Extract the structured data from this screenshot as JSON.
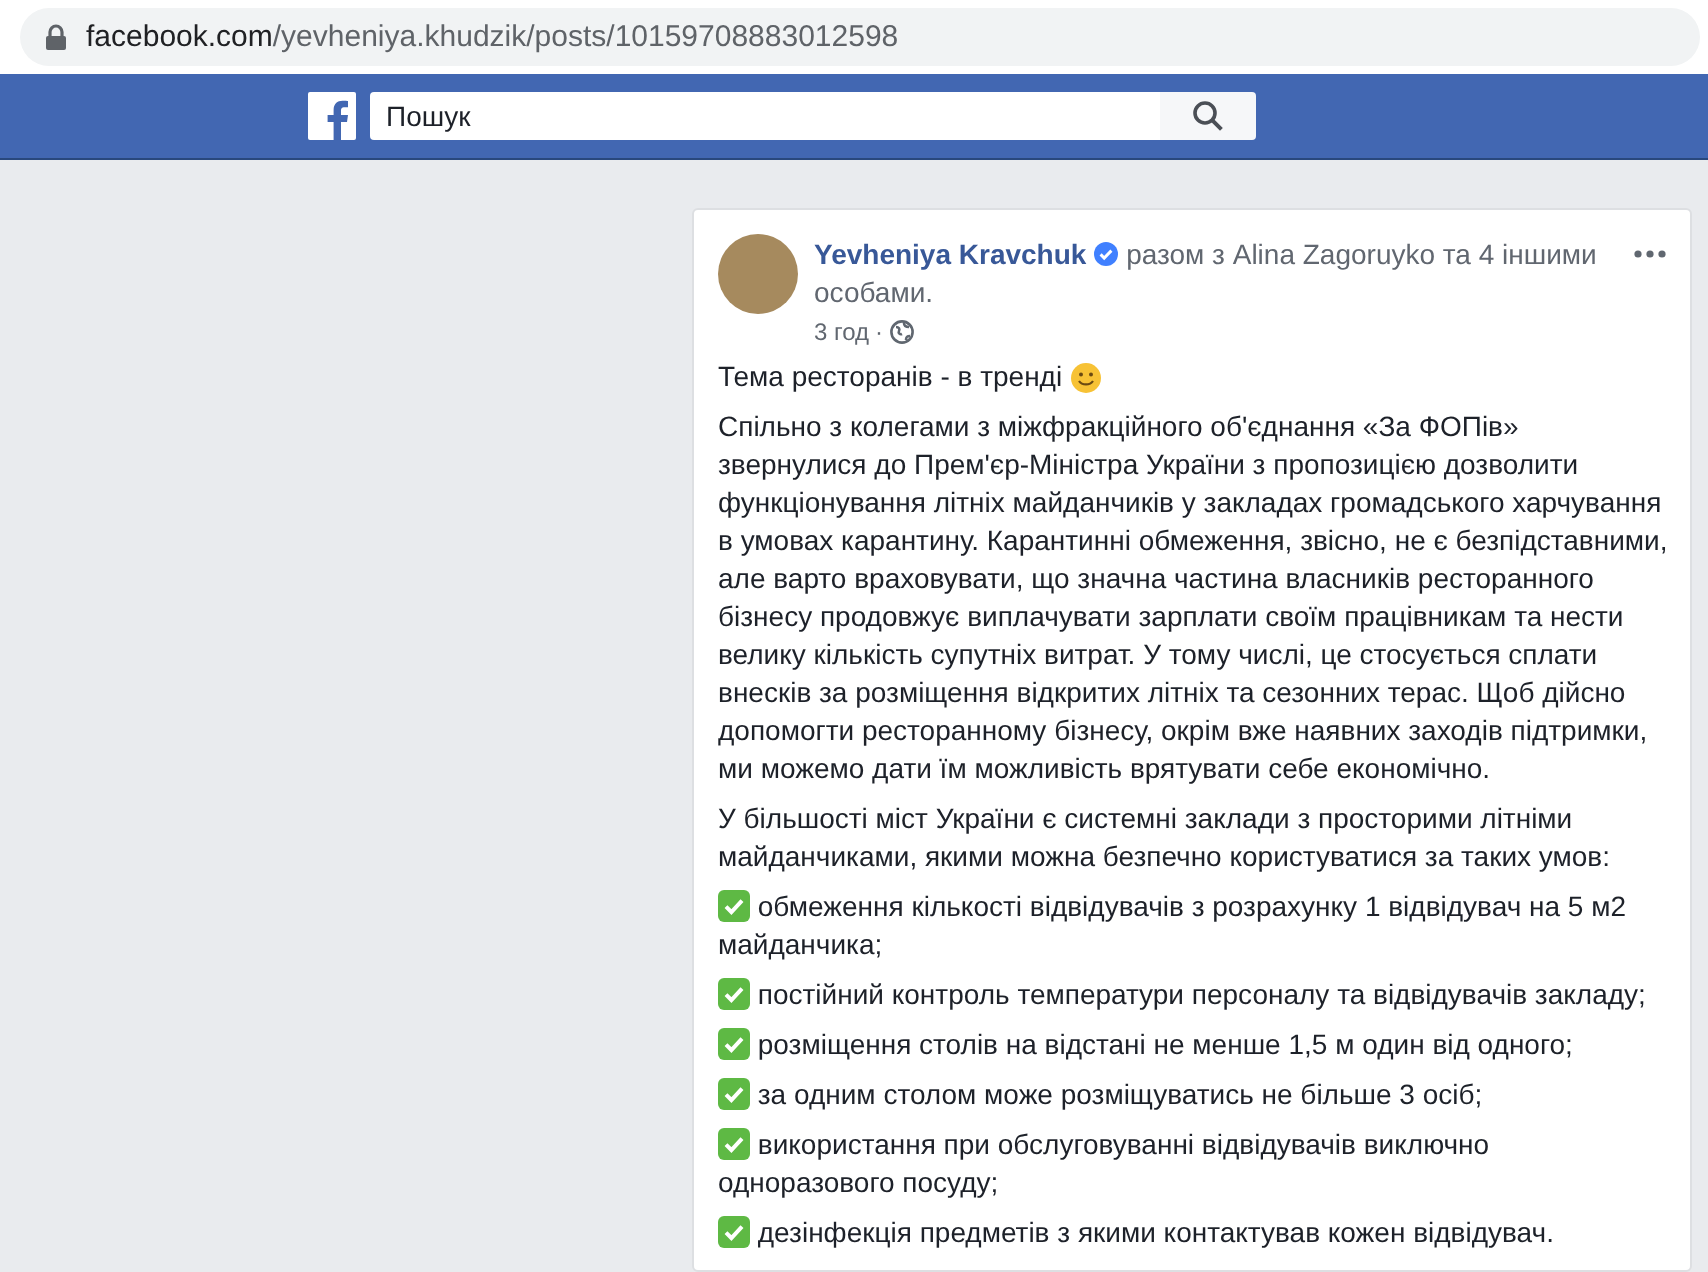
{
  "browser": {
    "url_host": "facebook.com",
    "url_path": "/yevheniya.khudzik/posts/10159708883012598"
  },
  "topbar": {
    "search": {
      "placeholder": "Пошук"
    }
  },
  "post": {
    "author": "Yevheniya Kravchuk",
    "verified": true,
    "with_text": "разом з Alina Zagoruyko та 4 іншими особами.",
    "time": "3 год",
    "separator": "·",
    "headline": "Тема ресторанів - в тренді",
    "paragraphs": [
      "Спільно з колегами з міжфракційного об'єднання «За ФОПів» звернулися до Прем'єр-Міністра України з пропозицією дозволити функціонування літніх майданчиків у закладах громадського харчування в умовах карантину. Карантинні обмеження, звісно, не є безпідставними, але варто враховувати, що значна частина власників ресторанного бізнесу продовжує виплачувати зарплати своїм працівникам та нести велику кількість супутніх витрат. У тому числі, це стосується сплати внесків за розміщення відкритих літніх та сезонних терас. Щоб дійсно допомогти ресторанному бізнесу, окрім вже наявних заходів підтримки, ми можемо дати їм можливість врятувати себе економічно.",
      "У більшості міст України є системні заклади з просторими літніми майданчиками, якими можна безпечно користуватися за таких умов:"
    ],
    "checklist": [
      {
        "text": "обмеження кількості відвідувачів з розрахунку 1 відвідувач на 5 м2 майданчика;",
        "checked": true
      },
      {
        "text": "постійний контроль температури персоналу та відвідувачів закладу;",
        "checked": true
      },
      {
        "text": "розміщення столів на відстані не менше 1,5 м один від одного;",
        "checked": true
      },
      {
        "text": "за одним столом може розміщуватись не більше 3 осіб;",
        "checked": true
      },
      {
        "text": "використання при обслуговуванні відвідувачів виключно одноразового посуду;",
        "checked": true
      },
      {
        "text": "дезінфекція предметів з якими контактував кожен відвідувач.",
        "checked": true
      }
    ]
  }
}
